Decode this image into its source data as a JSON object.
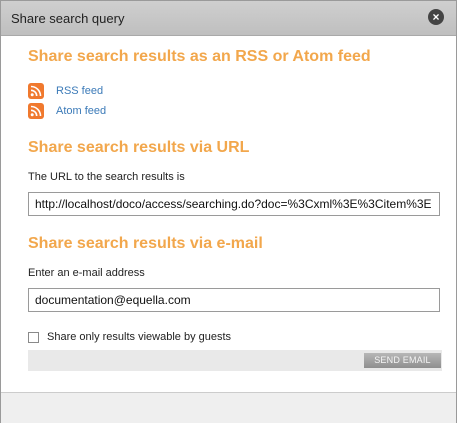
{
  "dialog": {
    "title": "Share search query",
    "close_icon": "close-icon"
  },
  "sections": {
    "feed": {
      "heading": "Share search results as an RSS or Atom feed",
      "links": [
        {
          "label": "RSS feed",
          "icon": "rss-icon"
        },
        {
          "label": "Atom feed",
          "icon": "rss-icon"
        }
      ]
    },
    "url": {
      "heading": "Share search results via URL",
      "label": "The URL to the search results is",
      "value": "http://localhost/doco/access/searching.do?doc=%3Cxml%3E%3Citem%3E"
    },
    "email": {
      "heading": "Share search results via e-mail",
      "label": "Enter an e-mail address",
      "value": "documentation@equella.com",
      "checkbox_label": "Share only results viewable by guests",
      "checkbox_checked": false,
      "send_button": "SEND EMAIL"
    }
  },
  "colors": {
    "heading": "#f2a74c",
    "link": "#3b7ab8",
    "feed_icon": "#f0792e",
    "button": "#9b9b9b"
  }
}
